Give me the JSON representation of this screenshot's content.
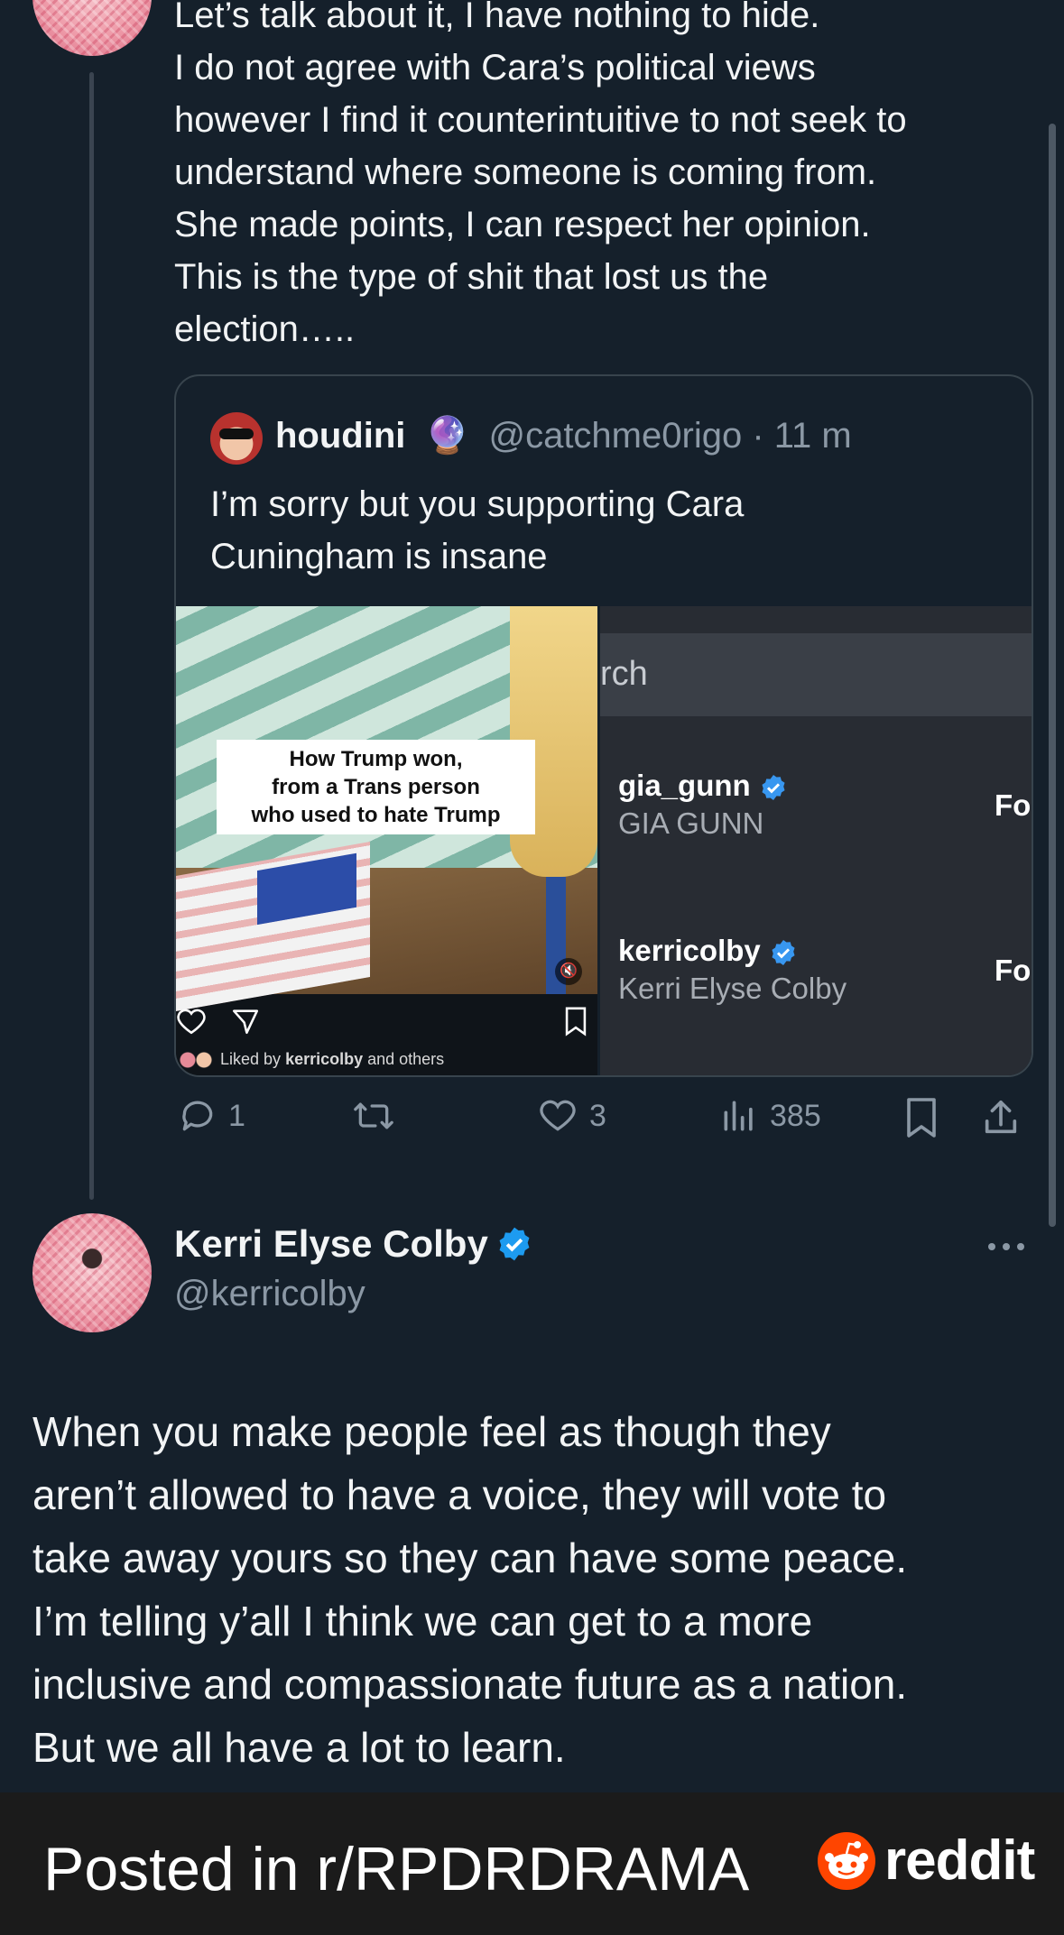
{
  "first_tweet": {
    "lines": [
      "Let’s talk about it, I have nothing to hide.",
      "I do not agree with Cara’s political views",
      "however I find it counterintuitive to not seek to",
      "understand where someone is coming from.",
      "She made points, I can respect her opinion.",
      "This is the type of shit that lost us the",
      "election….."
    ],
    "actions": {
      "replies": "1",
      "likes": "3",
      "views": "385"
    }
  },
  "quoted_tweet": {
    "name": "houdini",
    "emoji": "🔮",
    "handle": "@catchme0rigo",
    "time": "· 11 m",
    "text_lines": [
      "I’m sorry but you supporting Cara",
      "Cuningham is insane"
    ],
    "left_image": {
      "caption_lines": [
        "How Trump won,",
        "from a Trans person",
        "who used to hate Trump"
      ],
      "liked_by_prefix": "Liked by ",
      "liked_by_user": "kerricolby",
      "liked_by_suffix": " and others"
    },
    "right_image": {
      "search_text": "rch",
      "users": [
        {
          "username": "gia_gunn",
          "display": "GIA GUNN",
          "action": "Fo"
        },
        {
          "username": "kerricolby",
          "display": "Kerri Elyse Colby",
          "action": "Fo"
        }
      ]
    }
  },
  "second_tweet": {
    "name": "Kerri Elyse Colby",
    "handle": "@kerricolby",
    "lines": [
      "When you make people feel as though they",
      "aren’t allowed to have a voice, they will vote to",
      "take away yours so they can have some peace.",
      "I’m telling y’all I think we can get to a more",
      "inclusive and compassionate future as a nation.",
      "But we all have a lot to learn."
    ]
  },
  "footer": {
    "posted_in": "Posted in r/RPDRDRAMA",
    "brand": "reddit"
  },
  "colors": {
    "background": "#15202b",
    "verified": "#1d9bf0",
    "reddit": "#ff4500"
  }
}
